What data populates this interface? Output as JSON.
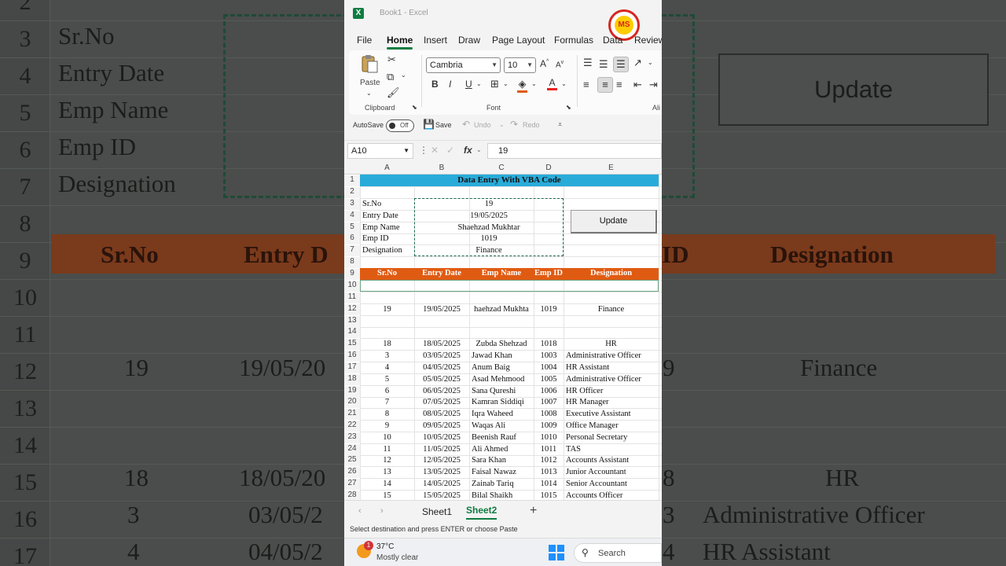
{
  "background": {
    "row_numbers": [
      "2",
      "3",
      "4",
      "5",
      "6",
      "7",
      "8",
      "9",
      "10",
      "11",
      "12",
      "13",
      "14",
      "15",
      "16",
      "17"
    ],
    "labels": [
      "Sr.No",
      "Entry Date",
      "Emp Name",
      "Emp ID",
      "Designation"
    ],
    "update_label": "Update",
    "headers": [
      "Sr.No",
      "Entry D",
      "ID",
      "Designation"
    ],
    "row12": [
      "19",
      "19/05/20",
      "9",
      "Finance"
    ],
    "row15": [
      "18",
      "18/05/20",
      "8",
      "HR"
    ],
    "row16": [
      "3",
      "03/05/2",
      "3",
      "Administrative Officer"
    ],
    "row17": [
      "4",
      "04/05/2",
      "4",
      "HR Assistant"
    ]
  },
  "window": {
    "app_icon": "X",
    "title": "Book1 - Excel",
    "logo_text": "MS"
  },
  "menu": {
    "tabs": [
      "File",
      "Home",
      "Insert",
      "Draw",
      "Page Layout",
      "Formulas",
      "Data",
      "Review"
    ],
    "active": "Home"
  },
  "ribbon": {
    "paste_label": "Paste",
    "clipboard_label": "Clipboard",
    "font_label": "Font",
    "alignment_label": "Ali",
    "font_name": "Cambria",
    "font_size": "10",
    "bold": "B",
    "italic": "I",
    "underline": "U",
    "grow_font": "A",
    "shrink_font": "A",
    "font_color": "A"
  },
  "qat": {
    "autosave_label": "AutoSave",
    "autosave_state": "Off",
    "save_label": "Save",
    "undo_label": "Undo",
    "redo_label": "Redo"
  },
  "formula_bar": {
    "cell_ref": "A10",
    "fx": "fx",
    "value": "19"
  },
  "sheet": {
    "columns": [
      "A",
      "B",
      "C",
      "D",
      "E"
    ],
    "rows": [
      "1",
      "2",
      "3",
      "4",
      "5",
      "6",
      "7",
      "8",
      "9",
      "10",
      "11",
      "12",
      "13",
      "14",
      "15",
      "16",
      "17",
      "18",
      "19",
      "20",
      "21",
      "22",
      "23",
      "24",
      "25",
      "26",
      "27",
      "28"
    ],
    "banner": "Data Entry With VBA Code",
    "form": {
      "labels": [
        "Sr.No",
        "Entry Date",
        "Emp Name",
        "Emp ID",
        "Designation"
      ],
      "values": [
        "19",
        "19/05/2025",
        "Shaehzad Mukhtar",
        "1019",
        "Finance"
      ]
    },
    "update_button": "Update",
    "headers": [
      "Sr.No",
      "Entry Date",
      "Emp Name",
      "Emp ID",
      "Designation"
    ],
    "records": [
      {
        "sr": "19",
        "date": "19/05/2025",
        "name": "haehzad Mukhta",
        "id": "1019",
        "designation": "Finance"
      },
      {
        "sr": "18",
        "date": "18/05/2025",
        "name": "Zubda Shehzad",
        "id": "1018",
        "designation": "HR"
      },
      {
        "sr": "3",
        "date": "03/05/2025",
        "name": "Jawad Khan",
        "id": "1003",
        "designation": "Administrative Officer"
      },
      {
        "sr": "4",
        "date": "04/05/2025",
        "name": "Anum Baig",
        "id": "1004",
        "designation": "HR Assistant"
      },
      {
        "sr": "5",
        "date": "05/05/2025",
        "name": "Asad Mehmood",
        "id": "1005",
        "designation": "Administrative Officer"
      },
      {
        "sr": "6",
        "date": "06/05/2025",
        "name": "Sana Qureshi",
        "id": "1006",
        "designation": "HR Officer"
      },
      {
        "sr": "7",
        "date": "07/05/2025",
        "name": "Kamran Siddiqi",
        "id": "1007",
        "designation": "HR Manager"
      },
      {
        "sr": "8",
        "date": "08/05/2025",
        "name": "Iqra Waheed",
        "id": "1008",
        "designation": "Executive Assistant"
      },
      {
        "sr": "9",
        "date": "09/05/2025",
        "name": "Waqas Ali",
        "id": "1009",
        "designation": "Office Manager"
      },
      {
        "sr": "10",
        "date": "10/05/2025",
        "name": "Beenish Rauf",
        "id": "1010",
        "designation": "Personal Secretary"
      },
      {
        "sr": "11",
        "date": "11/05/2025",
        "name": "Ali Ahmed",
        "id": "1011",
        "designation": "TAS"
      },
      {
        "sr": "12",
        "date": "12/05/2025",
        "name": "Sara Khan",
        "id": "1012",
        "designation": "Accounts Assistant"
      },
      {
        "sr": "13",
        "date": "13/05/2025",
        "name": "Faisal Nawaz",
        "id": "1013",
        "designation": "Junior Accountant"
      },
      {
        "sr": "14",
        "date": "14/05/2025",
        "name": "Zainab Tariq",
        "id": "1014",
        "designation": "Senior Accountant"
      },
      {
        "sr": "15",
        "date": "15/05/2025",
        "name": "Bilal Shaikh",
        "id": "1015",
        "designation": "Accounts Officer"
      }
    ]
  },
  "sheet_tabs": {
    "tabs": [
      "Sheet1",
      "Sheet2"
    ],
    "active": "Sheet2",
    "add": "+",
    "prev": "‹",
    "next": "›"
  },
  "status": {
    "message": "Select destination and press ENTER or choose Paste"
  },
  "taskbar": {
    "badge": "1",
    "temperature": "37°C",
    "condition": "Mostly clear",
    "search_label": "Search"
  },
  "colors": {
    "banner": "#29abd9",
    "header_band": "#e05b12",
    "excel_green": "#107c41"
  }
}
